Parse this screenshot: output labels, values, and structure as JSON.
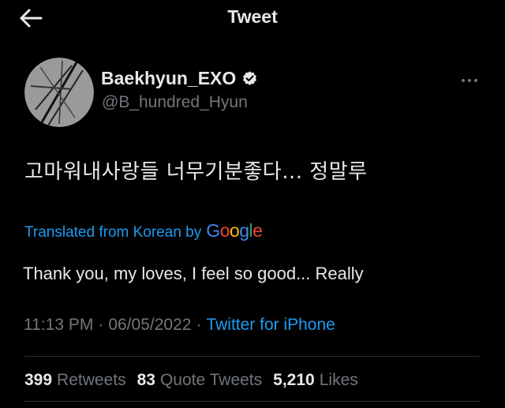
{
  "header": {
    "title": "Tweet"
  },
  "author": {
    "display_name": "Baekhyun_EXO",
    "handle": "@B_hundred_Hyun"
  },
  "tweet": {
    "text": "고마워내사랑들 너무기분좋다... 정말루",
    "translated_label": "Translated from Korean by",
    "translation_provider": "Google",
    "translation": "Thank you, my loves, I feel so good... Really",
    "time": "11:13 PM",
    "date": "06/05/2022",
    "separator": "·",
    "source": "Twitter for iPhone"
  },
  "stats": [
    {
      "count": "399",
      "label": "Retweets"
    },
    {
      "count": "83",
      "label": "Quote Tweets"
    },
    {
      "count": "5,210",
      "label": "Likes"
    }
  ],
  "colors": {
    "background": "#000000",
    "text": "#e7e9ea",
    "secondary": "#71767b",
    "link": "#1d9bf0",
    "divider": "#2f3336"
  },
  "icons": [
    "back-arrow-icon",
    "verified-badge-icon",
    "more-options-icon"
  ]
}
